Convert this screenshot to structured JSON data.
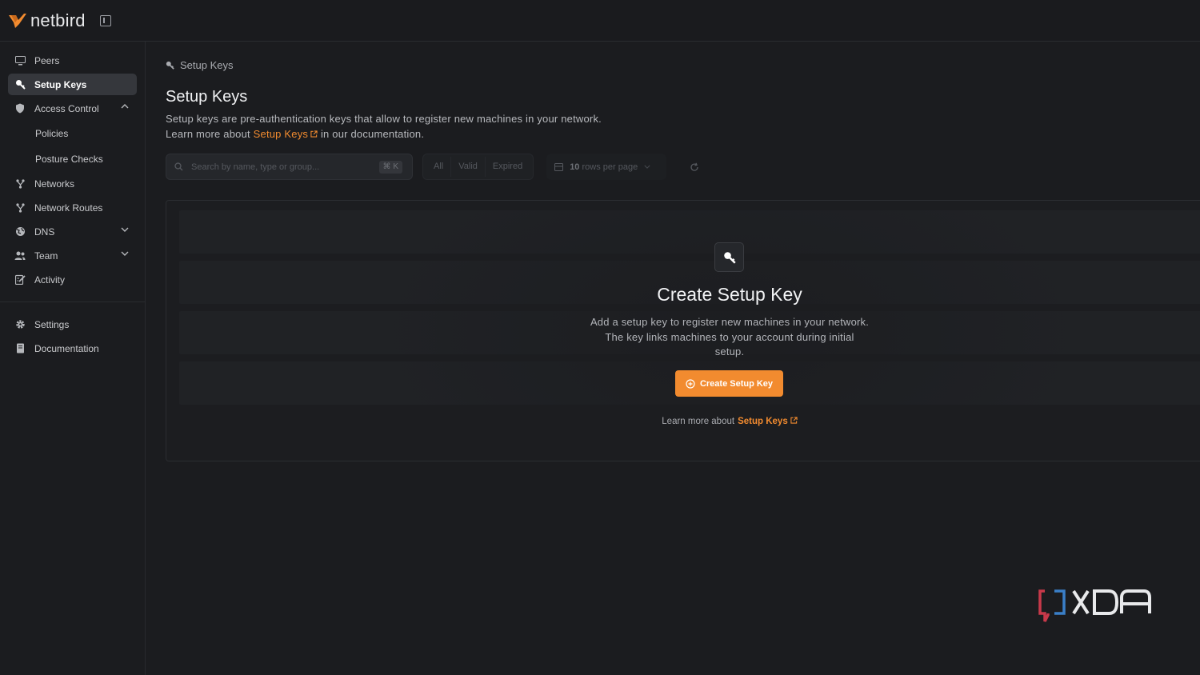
{
  "app": {
    "name": "netbird",
    "brand_color": "#f28b2f"
  },
  "sidebar": {
    "items": [
      {
        "label": "Peers",
        "icon": "monitor-icon",
        "active": false
      },
      {
        "label": "Setup Keys",
        "icon": "key-icon",
        "active": true
      },
      {
        "label": "Access Control",
        "icon": "shield-icon",
        "active": false,
        "expanded": true
      },
      {
        "label": "Policies",
        "sub": true
      },
      {
        "label": "Posture Checks",
        "sub": true
      },
      {
        "label": "Networks",
        "icon": "network-icon",
        "active": false
      },
      {
        "label": "Network Routes",
        "icon": "network-routes-icon",
        "active": false
      },
      {
        "label": "DNS",
        "icon": "globe-icon",
        "active": false,
        "expanded": false
      },
      {
        "label": "Team",
        "icon": "users-icon",
        "active": false,
        "expanded": false
      },
      {
        "label": "Activity",
        "icon": "activity-icon",
        "active": false
      }
    ],
    "footer_items": [
      {
        "label": "Settings",
        "icon": "gear-icon"
      },
      {
        "label": "Documentation",
        "icon": "book-icon"
      }
    ]
  },
  "breadcrumb": {
    "label": "Setup Keys"
  },
  "page": {
    "title": "Setup Keys",
    "description_line1": "Setup keys are pre-authentication keys that allow to register new machines in your network.",
    "description_prefix": "Learn more about",
    "description_link": "Setup Keys",
    "description_suffix": "in our documentation."
  },
  "toolbar": {
    "search_placeholder": "Search by name, type or group...",
    "search_shortcut": "⌘ K",
    "filters": [
      "All",
      "Valid",
      "Expired"
    ],
    "rows_count": "10",
    "rows_label": "rows per page"
  },
  "empty_state": {
    "title": "Create Setup Key",
    "description": "Add a setup key to register new machines in your network. The key links machines to your account during initial setup.",
    "button_label": "Create Setup Key",
    "learn_prefix": "Learn more about",
    "learn_link": "Setup Keys"
  }
}
